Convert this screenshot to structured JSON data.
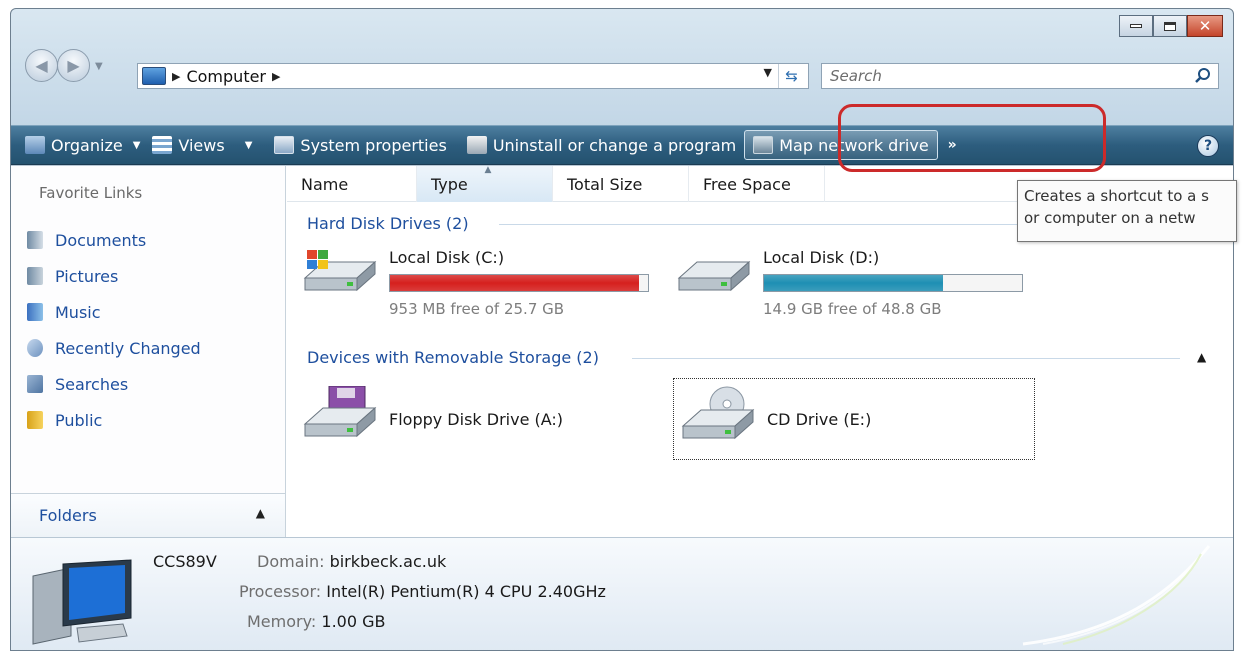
{
  "address": {
    "crumb": "Computer",
    "search_placeholder": "Search"
  },
  "toolbar": {
    "organize": "Organize",
    "views": "Views",
    "system_properties": "System properties",
    "uninstall": "Uninstall or change a program",
    "map_network_drive": "Map network drive",
    "overflow": "»"
  },
  "sidebar": {
    "title": "Favorite Links",
    "items": [
      "Documents",
      "Pictures",
      "Music",
      "Recently Changed",
      "Searches",
      "Public"
    ],
    "folders_label": "Folders"
  },
  "columns": [
    "Name",
    "Type",
    "Total Size",
    "Free Space"
  ],
  "groups": {
    "hard_disks": "Hard Disk Drives (2)",
    "removable": "Devices with Removable Storage (2)"
  },
  "drives": {
    "c": {
      "name": "Local Disk (C:)",
      "free_text": "953 MB free of 25.7 GB",
      "used_fraction": 0.964,
      "bar_color": "#d6201e"
    },
    "d": {
      "name": "Local Disk (D:)",
      "free_text": "14.9 GB free of 48.8 GB",
      "used_fraction": 0.695,
      "bar_color": "#1e8fb3"
    },
    "a": {
      "name": "Floppy Disk Drive (A:)"
    },
    "e": {
      "name": "CD Drive (E:)"
    }
  },
  "tooltip": {
    "line1": "Creates a shortcut to a s",
    "line2": "or computer on a netw"
  },
  "details": {
    "computer_name": "CCS89V",
    "domain_label": "Domain:",
    "domain_value": "birkbeck.ac.uk",
    "processor_label": "Processor:",
    "processor_value": "Intel(R) Pentium(R) 4 CPU 2.40GHz",
    "memory_label": "Memory:",
    "memory_value": "1.00 GB"
  },
  "colors": {
    "toolbar": "#2d5d7e",
    "link": "#1e4f9e",
    "highlight": "#cc2a2a"
  }
}
